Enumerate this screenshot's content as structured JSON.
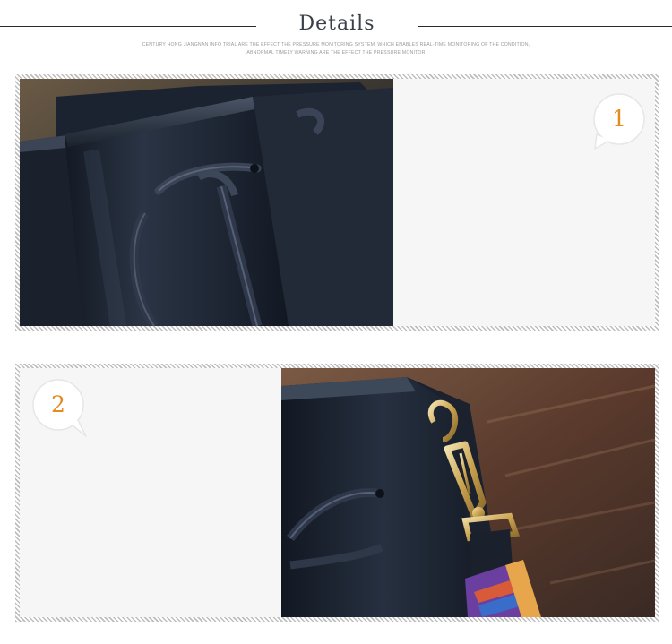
{
  "header": {
    "title": "Details",
    "subtitle_line1": "Century Hong Jiangnan info trial are the effect the pressure monitoring system, which enables real-time monitoring of the condition,",
    "subtitle_line2": "abnormal timely warning are the effect the pressure monitor"
  },
  "details": [
    {
      "number": "1",
      "photo_icon": "bag-drawstring-closeup-photo"
    },
    {
      "number": "2",
      "photo_icon": "bag-strap-buckle-closeup-photo"
    }
  ],
  "colors": {
    "number_accent": "#e58a22",
    "title": "#3a3f4a",
    "panel_bg": "#f6f6f6",
    "bag_leather": "#1f2837"
  }
}
